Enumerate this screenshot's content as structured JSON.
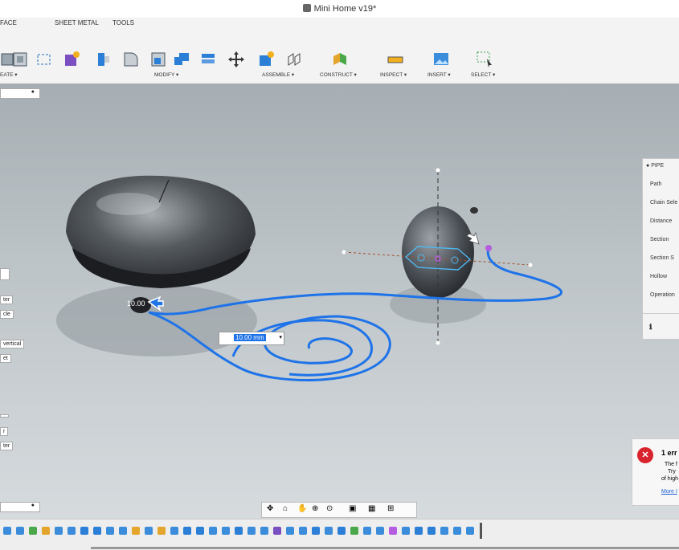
{
  "window": {
    "title": "Mini Home v19*"
  },
  "ribbon": {
    "tabs": [
      "FACE",
      "SHEET METAL",
      "TOOLS"
    ],
    "groups": [
      "EATE ▾",
      "MODIFY ▾",
      "ASSEMBLE ▾",
      "CONSTRUCT ▾",
      "INSPECT ▾",
      "INSERT ▾",
      "SELECT ▾"
    ]
  },
  "left_panel": {
    "labels": [
      "ter",
      "cle",
      "vertical",
      "et",
      "r",
      "ter"
    ]
  },
  "viewport": {
    "dimension_value": "10.00 mm",
    "overlay_label": "10.00"
  },
  "pipe_panel": {
    "header": "PIPE",
    "rows": [
      "Path",
      "Chain Sele",
      "Distance",
      "Section",
      "Section S",
      "Hollow",
      "Operation"
    ]
  },
  "error_toast": {
    "title": "1 err",
    "line1": "The f",
    "line2": "Try",
    "line3": "of high",
    "link": "More I"
  },
  "colors": {
    "accent": "#1e73e8",
    "error": "#d9232e"
  }
}
